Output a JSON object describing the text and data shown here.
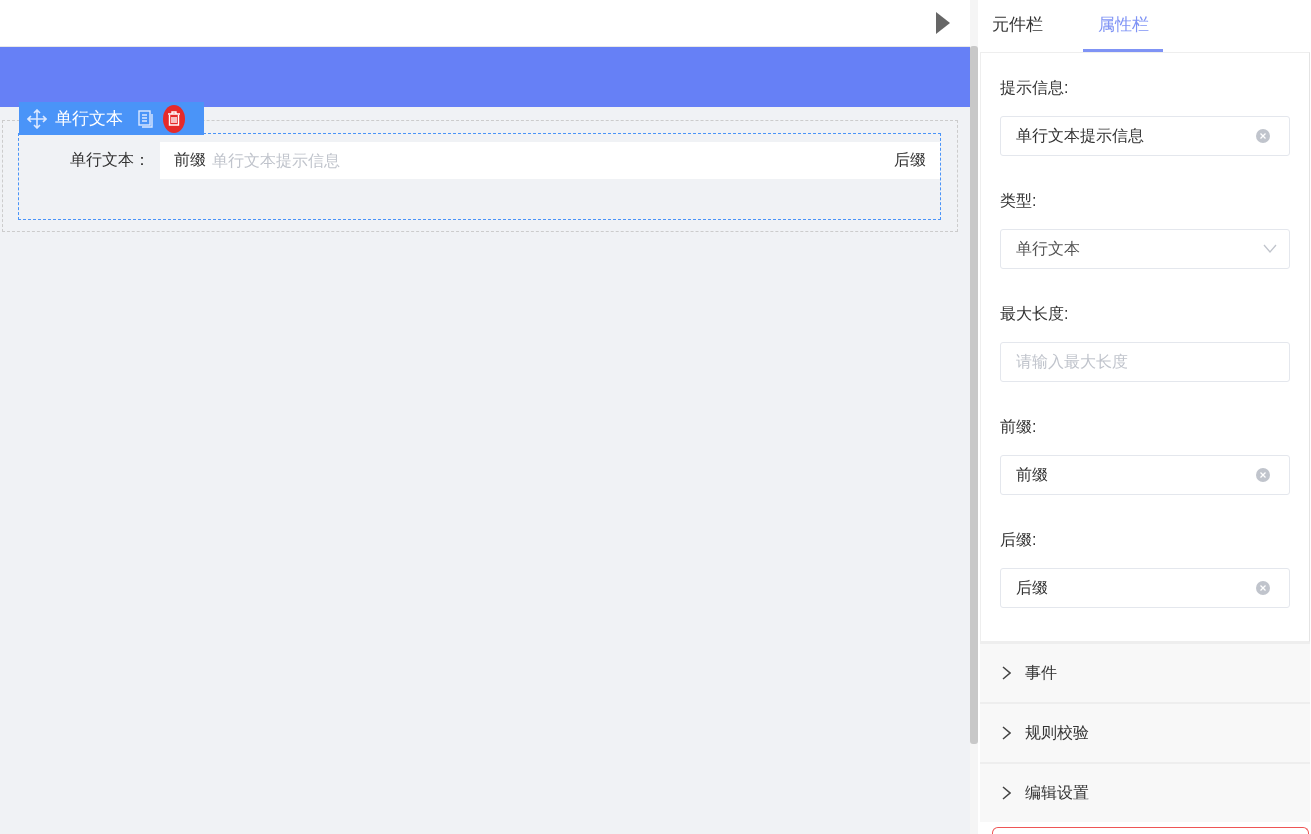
{
  "canvas": {
    "component_toolbar": {
      "title": "单行文本"
    },
    "field": {
      "label": "单行文本：",
      "prefix": "前缀",
      "placeholder": "单行文本提示信息",
      "suffix": "后缀"
    }
  },
  "panel": {
    "tabs": [
      {
        "label": "元件栏",
        "selected": false
      },
      {
        "label": "属性栏",
        "selected": true
      }
    ],
    "properties": [
      {
        "kind": "input",
        "label": "提示信息:",
        "value": "单行文本提示信息"
      },
      {
        "kind": "select",
        "label": "类型:",
        "value": "单行文本"
      },
      {
        "kind": "input",
        "label": "最大长度:",
        "placeholder": "请输入最大长度"
      },
      {
        "kind": "input",
        "label": "前缀:",
        "value": "前缀"
      },
      {
        "kind": "input",
        "label": "后缀:",
        "value": "后缀"
      }
    ],
    "sections": [
      {
        "label": "事件",
        "expanded": false
      },
      {
        "label": "规则校验",
        "expanded": false
      },
      {
        "label": "编辑设置",
        "expanded": false
      }
    ]
  }
}
